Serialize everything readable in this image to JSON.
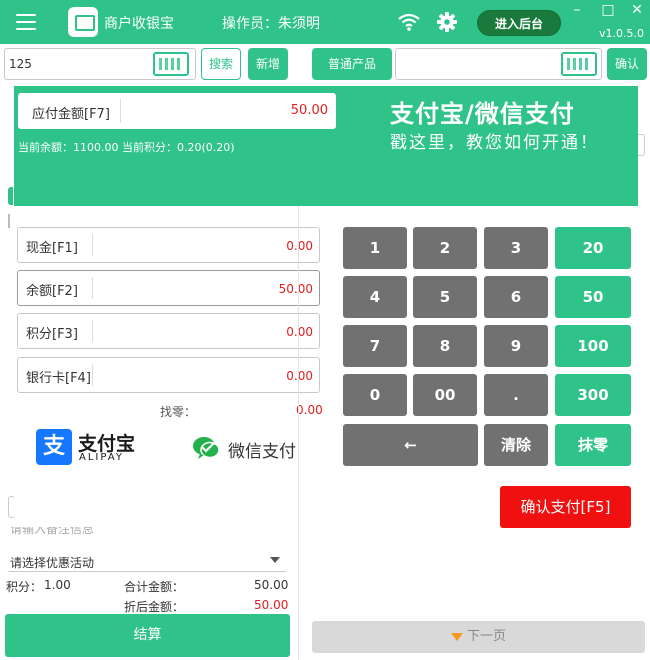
{
  "titlebar": {
    "app_title": "商户收银宝",
    "operator": "操作员：朱须明",
    "backend_button": "进入后台",
    "version": "v1.0.5.0",
    "minimize": "–",
    "maximize": "□",
    "close": "✕"
  },
  "toolbar": {
    "search_value": "125",
    "search_button": "搜索",
    "add_button": "新增",
    "product_button": "普通产品",
    "confirm_button": "确认"
  },
  "banner": {
    "due_label": "应付金额[F7]",
    "due_value": "50.00",
    "balance_info": "当前余额：1100.00 当前积分：0.20(0.20)",
    "promo_title": "支付宝/微信支付",
    "promo_sub": "戳这里，教您如何开通！"
  },
  "payment": {
    "fields": [
      {
        "label": "现金[F1]",
        "value": "0.00"
      },
      {
        "label": "余额[F2]",
        "value": "50.00"
      },
      {
        "label": "积分[F3]",
        "value": "0.00"
      },
      {
        "label": "银行卡[F4]",
        "value": "0.00"
      }
    ],
    "change_label": "找零：",
    "change_value": "0.00"
  },
  "logos": {
    "alipay_mark": "支",
    "alipay_cn": "支付宝",
    "alipay_en": "ALIPAY",
    "wechat_text": "微信支付"
  },
  "keypad": {
    "keys": [
      "1",
      "2",
      "3",
      "20",
      "4",
      "5",
      "6",
      "50",
      "7",
      "8",
      "9",
      "100",
      "0",
      "00",
      ".",
      "300"
    ],
    "backspace": "←",
    "clear": "清除",
    "round_off": "抹零",
    "confirm_pay": "确认支付[F5]"
  },
  "order": {
    "remark_placeholder": "请输入备注信息",
    "promo_select": "请选择优惠活动",
    "points_label": "积分：",
    "points_value": "1.00",
    "total_label": "合计金额：",
    "total_value": "50.00",
    "discount_label": "折后金额：",
    "discount_value": "50.00",
    "settle_button": "结算",
    "next_page": "下一页"
  },
  "colors": {
    "brand_green": "#2fc38a",
    "key_gray": "#717171",
    "danger_red": "#f01010",
    "amount_red": "#e02020"
  }
}
